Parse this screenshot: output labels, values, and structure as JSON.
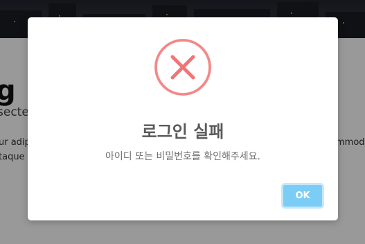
{
  "background": {
    "title": "g",
    "subtitle": "secteti",
    "line1": "ur adip",
    "line2": "taque",
    "right_text": "mmod"
  },
  "dialog": {
    "icon": "error-x-circle-icon",
    "icon_color": "#f27474",
    "title": "로그인 실패",
    "message": "아이디 또는 비밀번호를 확인해주세요.",
    "ok_label": "OK",
    "ok_color": "#7ccdf6"
  }
}
